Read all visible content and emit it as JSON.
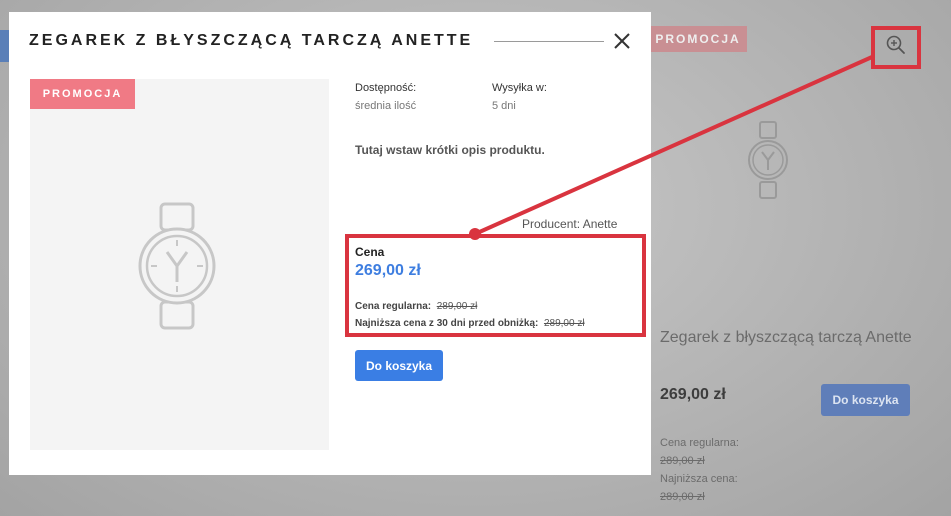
{
  "background": {
    "promo_badge": "PROMOCJA",
    "product_title": "Zegarek z błyszczącą tarczą Anette",
    "price": "269,00 zł",
    "cart_button": "Do koszyka",
    "regular_price_label": "Cena regularna:",
    "regular_price": "289,00 zł",
    "lowest_price_label": "Najniższa cena:",
    "lowest_price": "289,00 zł",
    "zoom_icon": "zoom-in-icon"
  },
  "modal": {
    "title": "ZEGAREK Z BŁYSZCZĄCĄ TARCZĄ ANETTE",
    "close_icon": "close-icon",
    "promo_badge": "PROMOCJA",
    "image_icon": "watch-icon",
    "availability_label": "Dostępność:",
    "availability_value": "średnia ilość",
    "shipping_label": "Wysyłka w:",
    "shipping_value": "5 dni",
    "short_description": "Tutaj wstaw krótki opis produktu.",
    "producer": "Producent: Anette",
    "price_label": "Cena",
    "price": "269,00 zł",
    "regular_price_label": "Cena regularna:",
    "regular_price": "289,00 zł",
    "lowest_price_label": "Najniższa cena z 30 dni przed obniżką:",
    "lowest_price": "289,00 zł",
    "cart_button": "Do koszyka"
  },
  "colors": {
    "annotation_red": "#d9343f",
    "accent_blue": "#3a7ee4",
    "promo_pink": "#f07a85"
  }
}
